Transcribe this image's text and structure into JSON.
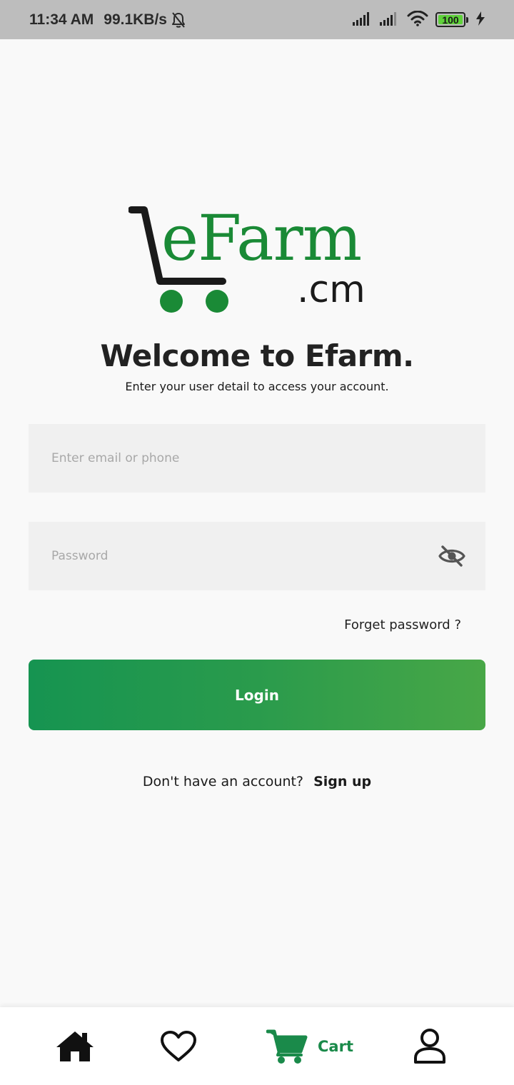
{
  "status_bar": {
    "time": "11:34 AM",
    "network_speed": "99.1KB/s",
    "battery_level": "100",
    "icons": [
      "bell-off-icon",
      "signal-icon",
      "signal-icon",
      "wifi-icon",
      "battery-icon",
      "charging-icon"
    ]
  },
  "logo": {
    "main": "eFarm",
    "sub": ".cm",
    "icon": "shopping-cart-icon"
  },
  "welcome": {
    "title": "Welcome to Efarm.",
    "subtitle": "Enter your user detail to access your account."
  },
  "form": {
    "email_placeholder": "Enter email or phone",
    "email_value": "",
    "password_placeholder": "Password",
    "password_value": "",
    "password_toggle_icon": "eye-off-icon",
    "forgot_label": "Forget password ?",
    "login_label": "Login"
  },
  "signup": {
    "prompt": "Don't have an account?",
    "link": "Sign up"
  },
  "bottom_nav": {
    "items": [
      {
        "icon": "home-icon",
        "label": ""
      },
      {
        "icon": "heart-icon",
        "label": ""
      },
      {
        "icon": "cart-icon",
        "label": "Cart",
        "active": true
      },
      {
        "icon": "user-icon",
        "label": ""
      }
    ]
  },
  "colors": {
    "brand_green": "#1a8a36",
    "button_gradient_start": "#169451",
    "button_gradient_end": "#48a747",
    "active_nav": "#1a8a4a",
    "status_bar_bg": "#bdbdbd"
  }
}
